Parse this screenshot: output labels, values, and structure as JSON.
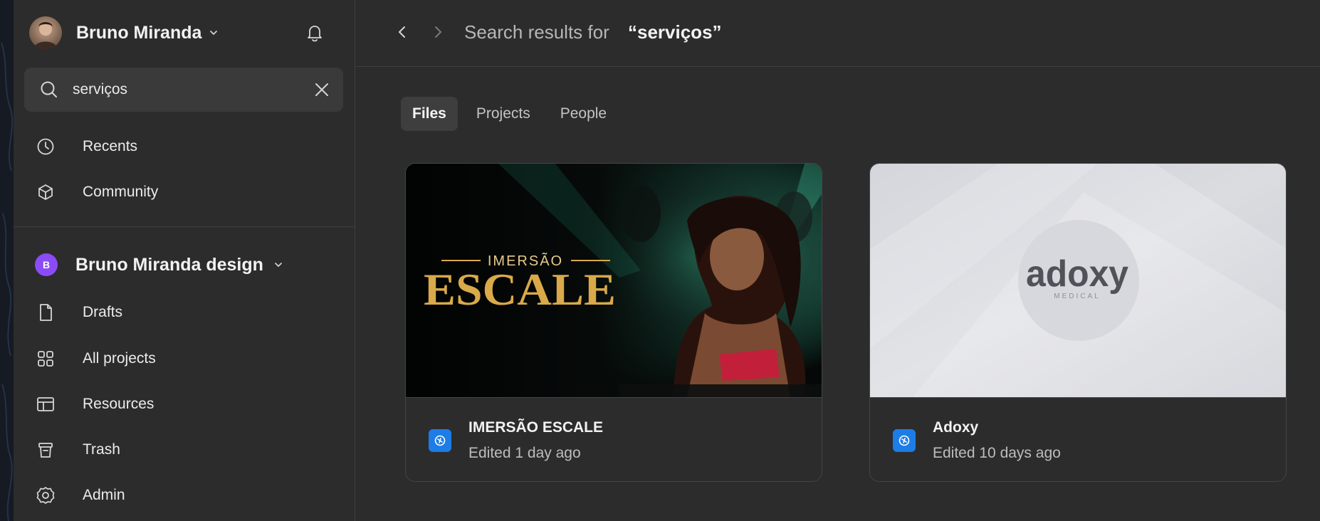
{
  "user": {
    "name": "Bruno Miranda"
  },
  "search": {
    "value": "serviços",
    "placeholder": ""
  },
  "nav_top": [
    {
      "label": "Recents",
      "icon": "clock-icon"
    },
    {
      "label": "Community",
      "icon": "community-icon"
    }
  ],
  "team": {
    "badge": "B",
    "name": "Bruno Miranda design",
    "badge_color": "#8b4cf7"
  },
  "nav_team": [
    {
      "label": "Drafts",
      "icon": "file-icon"
    },
    {
      "label": "All projects",
      "icon": "grid-icon"
    },
    {
      "label": "Resources",
      "icon": "layout-icon"
    },
    {
      "label": "Trash",
      "icon": "trash-icon"
    },
    {
      "label": "Admin",
      "icon": "gear-icon"
    }
  ],
  "header": {
    "prefix": "Search results for",
    "query": "“serviços”"
  },
  "tabs": [
    {
      "label": "Files",
      "active": true
    },
    {
      "label": "Projects",
      "active": false
    },
    {
      "label": "People",
      "active": false
    }
  ],
  "files": [
    {
      "title": "IMERSÃO ESCALE",
      "edited": "Edited 1 day ago",
      "thumb_small": "IMERSÃO",
      "thumb_big": "ESCALE"
    },
    {
      "title": "Adoxy",
      "edited": "Edited 10 days ago",
      "thumb_logo": "adoxy",
      "thumb_sub": "MEDICAL"
    }
  ],
  "colors": {
    "accent_file": "#1d7ce6",
    "background": "#2c2c2c"
  }
}
